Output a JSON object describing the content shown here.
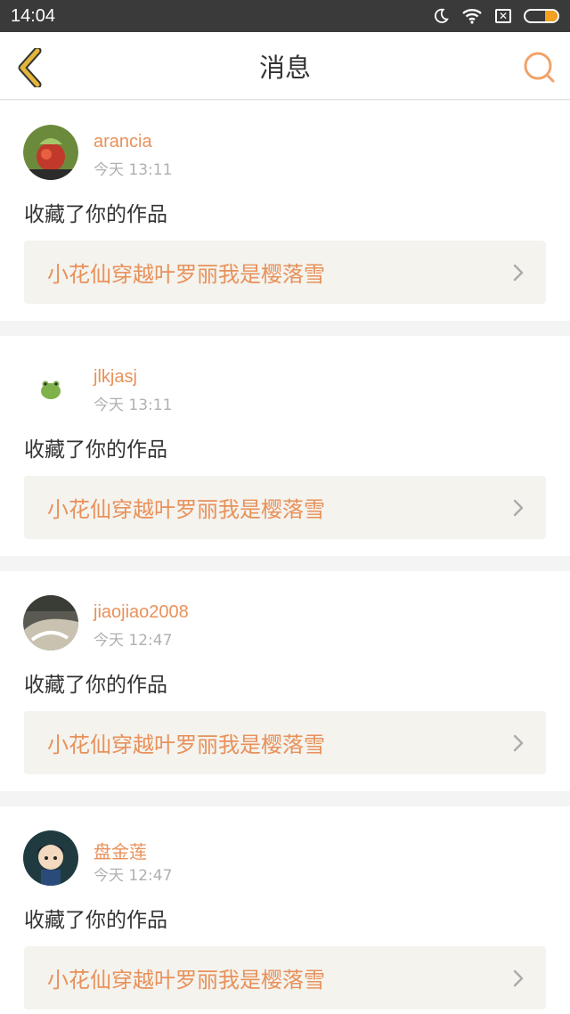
{
  "status_bar": {
    "time": "14:04"
  },
  "header": {
    "title": "消息"
  },
  "colors": {
    "accent": "#e8915a",
    "back_icon": "#e2b63c",
    "link_bg": "#f4f3ee"
  },
  "notifications": [
    {
      "username": "arancia",
      "time": "今天 13:11",
      "action": "收藏了你的作品",
      "work": "小花仙穿越叶罗丽我是樱落雪"
    },
    {
      "username": "jlkjasj",
      "time": "今天 13:11",
      "action": "收藏了你的作品",
      "work": "小花仙穿越叶罗丽我是樱落雪"
    },
    {
      "username": "jiaojiao2008",
      "time": "今天 12:47",
      "action": "收藏了你的作品",
      "work": "小花仙穿越叶罗丽我是樱落雪"
    },
    {
      "username": "盘金莲",
      "time": "今天 12:47",
      "action": "收藏了你的作品",
      "work": "小花仙穿越叶罗丽我是樱落雪"
    }
  ]
}
